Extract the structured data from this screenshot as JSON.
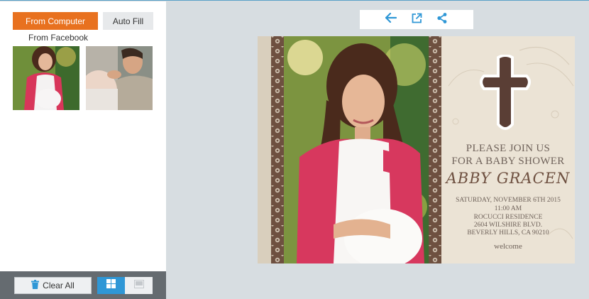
{
  "sidebar": {
    "from_computer_label": "From Computer",
    "auto_fill_label": "Auto Fill",
    "from_facebook_label": "From Facebook"
  },
  "bottom_bar": {
    "clear_all_label": "Clear All"
  },
  "card": {
    "line1": "PLEASE JOIN US",
    "line2": "FOR A BABY SHOWER",
    "name": "ABBY GRACEN",
    "date": "SATURDAY, NOVEMBER 6TH 2015",
    "time": "11:00 AM",
    "venue": "ROCUCCI RESIDENCE",
    "street": "2604 WILSHIRE BLVD.",
    "city": "BEVERLY HILLS, CA 90210",
    "welcome": "welcome"
  },
  "colors": {
    "accent": "#e8711f",
    "toggle_active": "#2f97d6",
    "toolbar_icon": "#2f97d6",
    "cross": "#5a3e35"
  },
  "icons": [
    "back-arrow-icon",
    "open-external-icon",
    "share-icon",
    "trash-icon",
    "grid-view-icon",
    "single-view-icon",
    "cross-icon"
  ]
}
